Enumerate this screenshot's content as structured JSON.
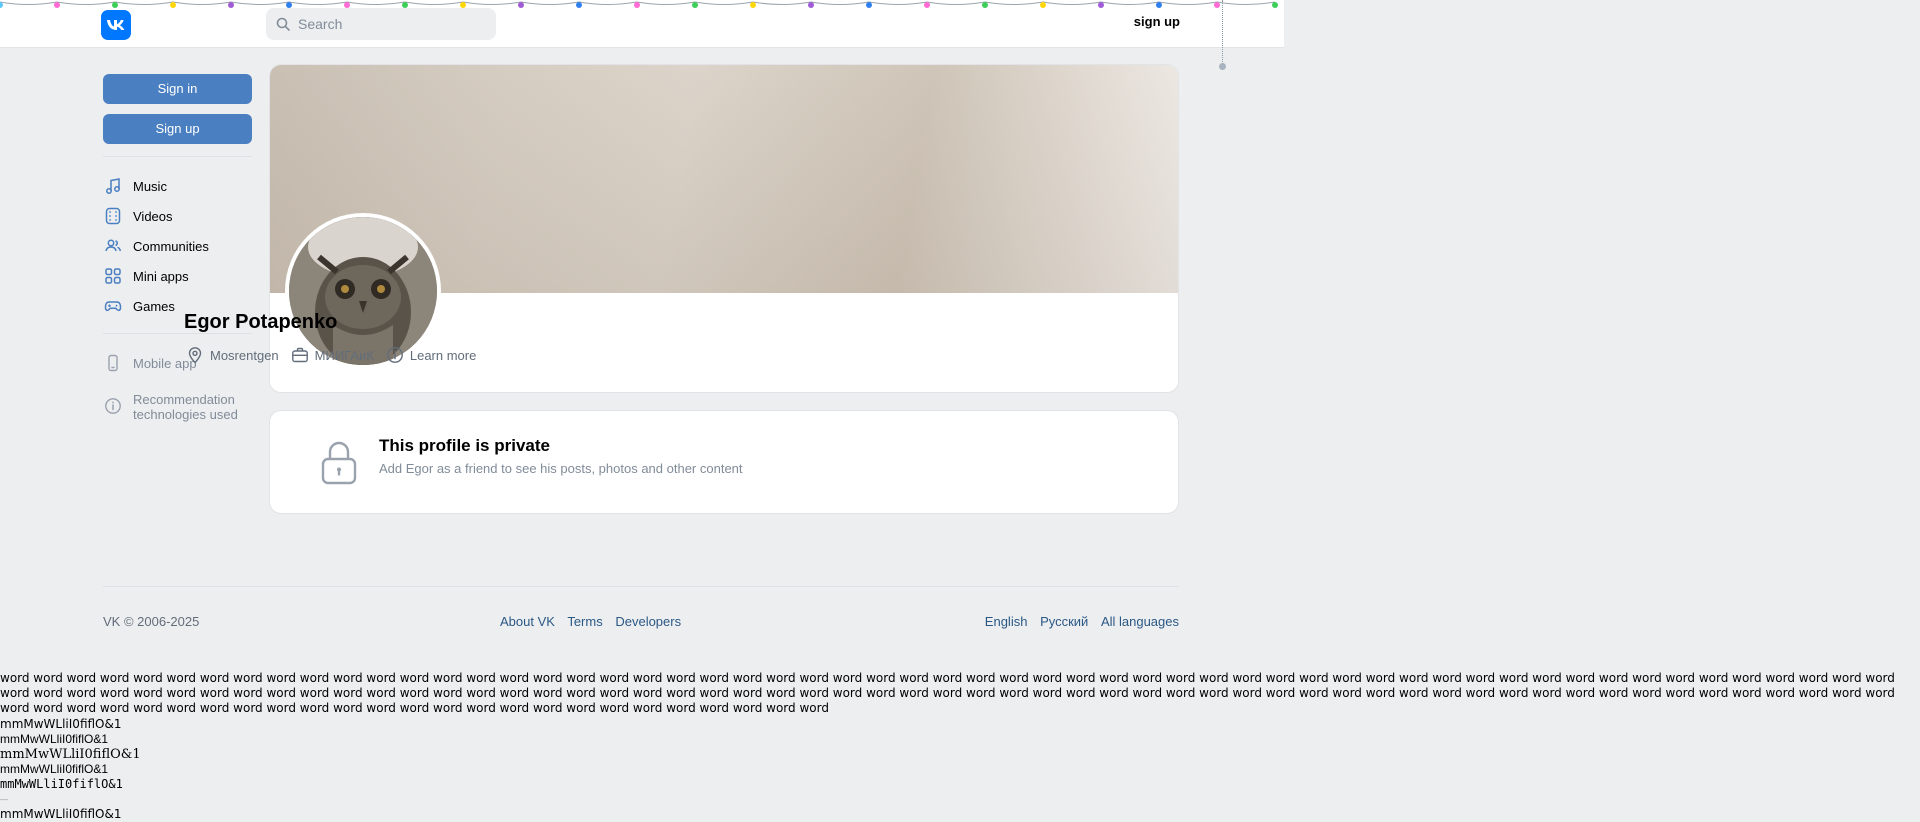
{
  "header": {
    "logo": "vk-logo-icon",
    "search_placeholder": "Search",
    "signup_label": "sign up"
  },
  "sidebar": {
    "sign_in_label": "Sign in",
    "sign_up_label": "Sign up",
    "items": [
      {
        "label": "Music",
        "icon": "music-icon"
      },
      {
        "label": "Videos",
        "icon": "video-icon"
      },
      {
        "label": "Communities",
        "icon": "users-icon"
      },
      {
        "label": "Mini apps",
        "icon": "grid-icon"
      },
      {
        "label": "Games",
        "icon": "gamepad-icon"
      }
    ],
    "mobile_app_label": "Mobile app",
    "recommendation_line1": "Recommendation",
    "recommendation_line2": "technologies used"
  },
  "profile": {
    "name": "Egor Potapenko",
    "location": "Mosrentgen",
    "work": "МИИГАиК",
    "learn_more": "Learn more"
  },
  "private": {
    "title": "This profile is private",
    "subtitle": "Add Egor as a friend to see his posts, photos and other content"
  },
  "footer": {
    "copyright": "VK © 2006-2025",
    "about": "About VK",
    "terms": "Terms",
    "developers": "Developers",
    "english": "English",
    "russian": "Русский",
    "all_languages": "All languages"
  },
  "test_text": {
    "words": "word word word word word word word word word word word word word word word word word word word word word word word word word word word word word word word word word word word word word word word word word word word word word word word word word word word word word word word word word word word word word word word word word word word word word word word word word word word word word word word word word word word word word word word word word word word word word word word word word word word word word word word word word word word word word word word word word word word word word word word word word word word word word word word word word word word word word word word word word word word",
    "font_line": "mmMwWLliI0fiflO&1",
    "dash": "—"
  },
  "colors": {
    "background": "#edeef0",
    "button": "#4a7fc1",
    "link": "#2a5885",
    "logo": "#0077ff"
  }
}
